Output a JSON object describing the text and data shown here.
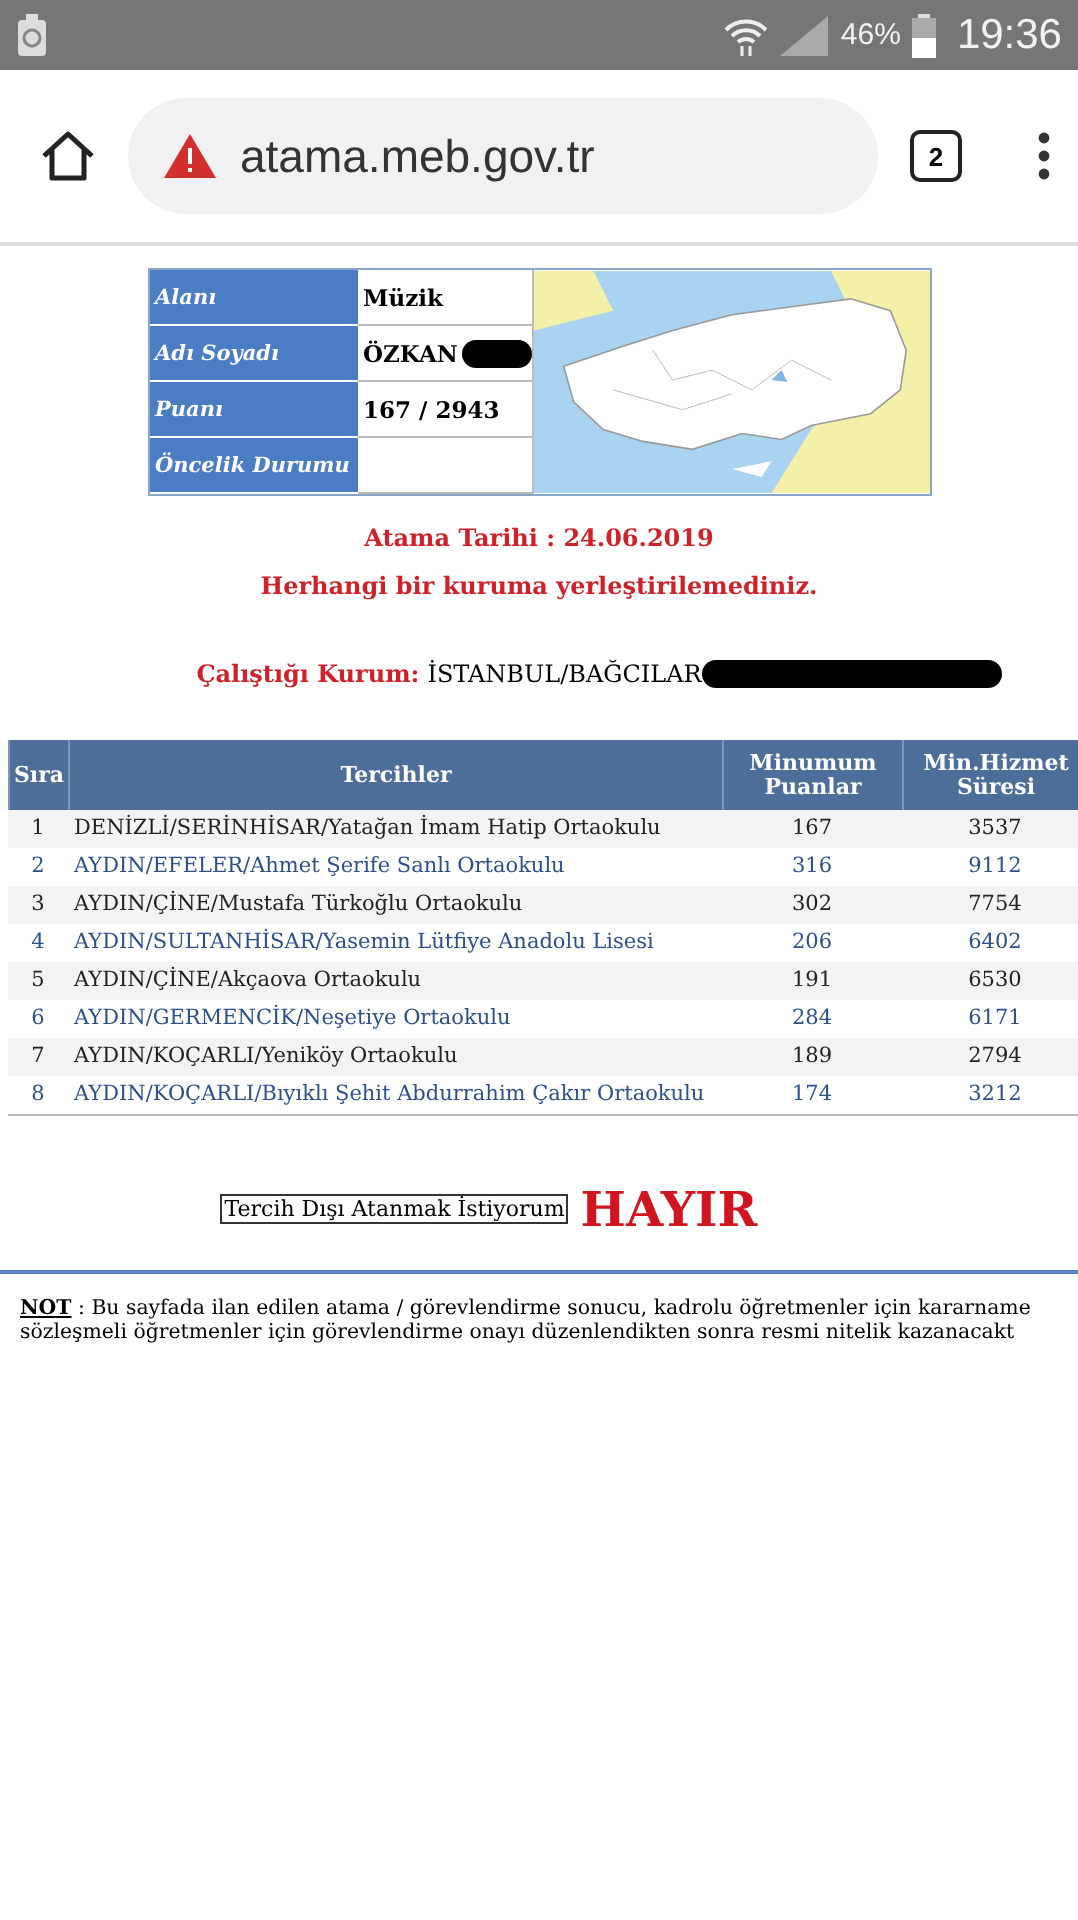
{
  "status_bar": {
    "battery_percent": "46%",
    "time": "19:36"
  },
  "browser": {
    "url": "atama.meb.gov.tr",
    "tab_count": "2"
  },
  "info": {
    "rows": [
      {
        "label": "Alanı",
        "value": "Müzik",
        "redacted": false
      },
      {
        "label": "Adı Soyadı",
        "value": "ÖZKAN",
        "redacted": true
      },
      {
        "label": "Puanı",
        "value": "167 / 2943",
        "redacted": false
      },
      {
        "label": "Öncelik Durumu",
        "value": "",
        "redacted": false
      }
    ]
  },
  "assignment_date": "Atama Tarihi : 24.06.2019",
  "result": "Herhangi bir kuruma yerleştirilemediniz.",
  "institution": {
    "label": "Çalıştığı Kurum:",
    "value": "İSTANBUL/BAĞCILAR",
    "redacted": true
  },
  "table": {
    "columns": [
      "Sıra",
      "Tercihler",
      "Minumum Puanlar",
      "Min.Hizmet Süresi"
    ],
    "rows": [
      {
        "cells": [
          "1",
          "DENİZLİ/SERİNHİSAR/Yatağan İmam Hatip Ortaokulu",
          "167",
          "3537"
        ]
      },
      {
        "cells": [
          "2",
          "AYDIN/EFELER/Ahmet Şerife Sanlı Ortaokulu",
          "316",
          "9112"
        ]
      },
      {
        "cells": [
          "3",
          "AYDIN/ÇİNE/Mustafa Türkoğlu Ortaokulu",
          "302",
          "7754"
        ]
      },
      {
        "cells": [
          "4",
          "AYDIN/SULTANHİSAR/Yasemin Lütfiye Anadolu Lisesi",
          "206",
          "6402"
        ]
      },
      {
        "cells": [
          "5",
          "AYDIN/ÇİNE/Akçaova Ortaokulu",
          "191",
          "6530"
        ]
      },
      {
        "cells": [
          "6",
          "AYDIN/GERMENCİK/Neşetiye Ortaokulu",
          "284",
          "6171"
        ]
      },
      {
        "cells": [
          "7",
          "AYDIN/KOÇARLI/Yeniköy Ortaokulu",
          "189",
          "2794"
        ]
      },
      {
        "cells": [
          "8",
          "AYDIN/KOÇARLI/Bıyıklı Şehit Abdurrahim Çakır Ortaokulu",
          "174",
          "3212"
        ]
      }
    ]
  },
  "preference": {
    "label": "Tercih Dışı Atanmak İstiyorum",
    "answer": "HAYIR"
  },
  "note": {
    "title": "NOT",
    "lines": [
      " : Bu sayfada ilan edilen atama / görevlendirme sonucu, kadrolu öğretmenler için kararname",
      "sözleşmeli öğretmenler için görevlendirme onayı düzenlendikten sonra resmi nitelik kazanacakt"
    ]
  }
}
